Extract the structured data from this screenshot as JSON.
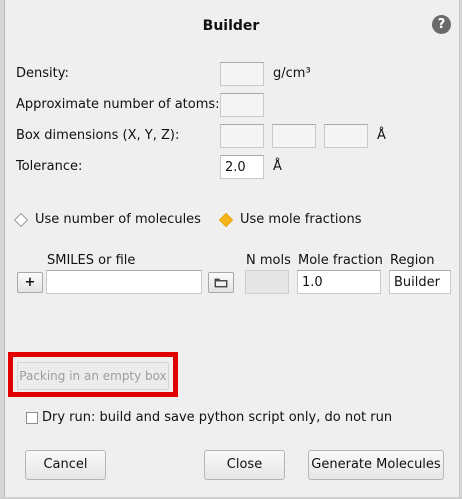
{
  "dialog": {
    "title": "Builder",
    "help_glyph": "?"
  },
  "form": {
    "density": {
      "label": "Density:",
      "value": "",
      "unit": "g/cm³"
    },
    "atoms": {
      "label": "Approximate number of atoms:",
      "value": ""
    },
    "box": {
      "label": "Box dimensions (X, Y, Z):",
      "x": "",
      "y": "",
      "z": "",
      "unit": "Å"
    },
    "tolerance": {
      "label": "Tolerance:",
      "value": "2.0",
      "unit": "Å"
    }
  },
  "mode": {
    "options": [
      {
        "label": "Use number of molecules",
        "selected": false
      },
      {
        "label": "Use mole fractions",
        "selected": true
      }
    ]
  },
  "table": {
    "headers": {
      "smiles": "SMILES or file",
      "nmols": "N mols",
      "fraction": "Mole fraction",
      "region": "Region"
    },
    "row": {
      "add_glyph": "+",
      "smiles": "",
      "nmols": "",
      "fraction": "1.0",
      "region": "Builder"
    }
  },
  "packing_button": "Packing in an empty box",
  "dry_run": {
    "label": "Dry run: build and save python script only, do not run",
    "checked": false
  },
  "buttons": {
    "cancel": "Cancel",
    "close": "Close",
    "generate": "Generate Molecules"
  },
  "icons": {
    "help": "help-icon",
    "folder": "folder-icon",
    "add": "plus-icon"
  },
  "colors": {
    "highlight": "#e30000",
    "radio_selected": "#f6b61b",
    "help_bg": "#6a6a6a"
  }
}
